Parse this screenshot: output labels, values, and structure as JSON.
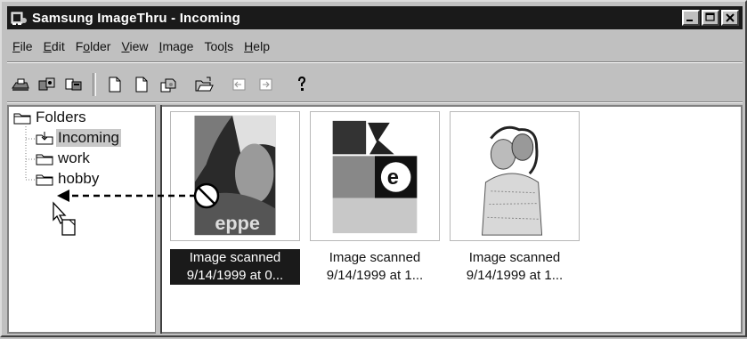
{
  "window": {
    "title": "Samsung ImageThru - Incoming",
    "buttons": [
      "minimize",
      "maximize",
      "close"
    ]
  },
  "menu": [
    {
      "label": "File",
      "key": "F",
      "rest": "ile"
    },
    {
      "label": "Edit",
      "key": "E",
      "rest": "dit"
    },
    {
      "label": "Folder",
      "key": "o",
      "pre": "F",
      "rest": "lder"
    },
    {
      "label": "View",
      "key": "V",
      "rest": "iew"
    },
    {
      "label": "Image",
      "key": "I",
      "rest": "mage"
    },
    {
      "label": "Tools",
      "key": "l",
      "pre": "Too",
      "rest": "s"
    },
    {
      "label": "Help",
      "key": "H",
      "rest": "elp"
    }
  ],
  "toolbar_icons": [
    "scanner-icon",
    "acquire-icon",
    "batch-scan-icon",
    "new-page-icon",
    "blank-page-icon",
    "copy-icon",
    "open-folder-icon",
    "previous-icon",
    "next-icon",
    "help-icon"
  ],
  "tree": {
    "root": "Folders",
    "items": [
      {
        "label": "Incoming",
        "selected": true
      },
      {
        "label": "work",
        "selected": false
      },
      {
        "label": "hobby",
        "selected": false
      }
    ]
  },
  "thumbnails": [
    {
      "line1": "Image scanned",
      "line2": "9/14/1999 at 0...",
      "selected": true
    },
    {
      "line1": "Image scanned",
      "line2": "9/14/1999 at 1...",
      "selected": false
    },
    {
      "line1": "Image scanned",
      "line2": "9/14/1999 at 1...",
      "selected": false
    }
  ],
  "colors": {
    "titlebar": "#1a1a1a",
    "window": "#c0c0c0",
    "selection": "#1a1a1a"
  }
}
